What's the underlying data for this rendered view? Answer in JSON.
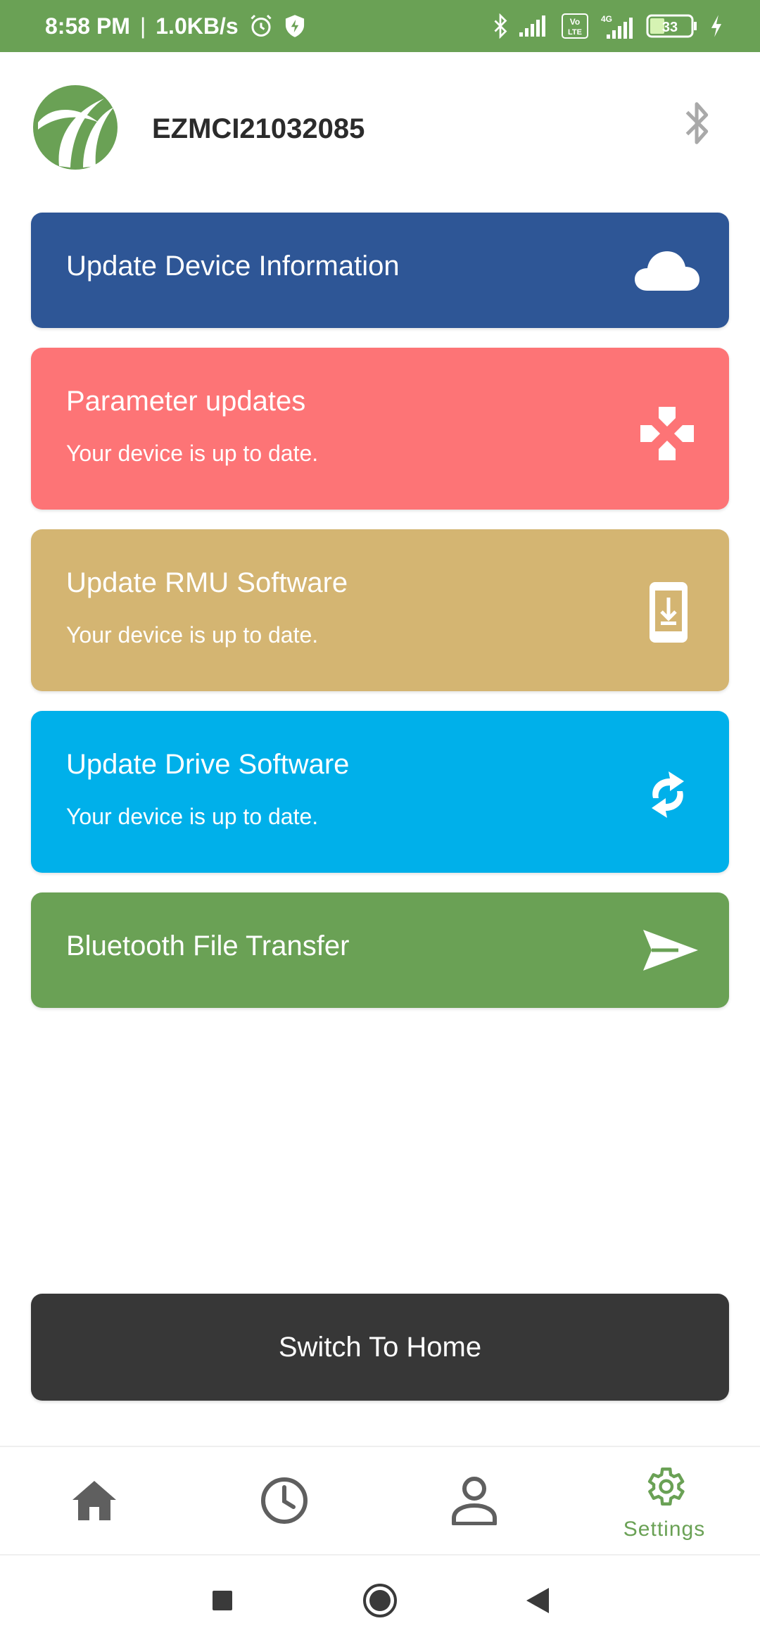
{
  "status_bar": {
    "time": "8:58 PM",
    "separator": "|",
    "speed": "1.0KB/s",
    "battery": "33",
    "network_4g": "4G",
    "volte": "Vo LTE",
    "icons": [
      "alarm-icon",
      "shield-icon",
      "bluetooth-icon",
      "signal-icon",
      "volte-icon",
      "signal-4g-icon",
      "battery-icon",
      "charging-icon"
    ]
  },
  "header": {
    "device_id": "EZMCI21032085",
    "bluetooth_icon": "bluetooth-icon"
  },
  "cards": [
    {
      "title": "Update Device Information",
      "subtitle": "",
      "color": "#2e5696",
      "icon": "cloud-icon"
    },
    {
      "title": "Parameter updates",
      "subtitle": "Your device is up to date.",
      "color": "#fd7476",
      "icon": "gamepad-icon"
    },
    {
      "title": "Update RMU Software",
      "subtitle": "Your device is up to date.",
      "color": "#d4b572",
      "icon": "phone-download-icon"
    },
    {
      "title": "Update Drive Software",
      "subtitle": "Your device is up to date.",
      "color": "#00b0ea",
      "icon": "sync-icon"
    },
    {
      "title": "Bluetooth File Transfer",
      "subtitle": "",
      "color": "#6aa155",
      "icon": "send-icon"
    }
  ],
  "switch_home": {
    "label": "Switch To Home",
    "color": "#373737"
  },
  "bottom_nav": {
    "items": [
      {
        "icon": "home-icon",
        "label": ""
      },
      {
        "icon": "clock-icon",
        "label": ""
      },
      {
        "icon": "person-icon",
        "label": ""
      },
      {
        "icon": "gear-icon",
        "label": "Settings",
        "active": true
      }
    ],
    "active_color": "#6aa155",
    "inactive_color": "#5f5f5f"
  },
  "system_nav": {
    "icons": [
      "recent-apps-icon",
      "home-circle-icon",
      "back-icon"
    ]
  }
}
